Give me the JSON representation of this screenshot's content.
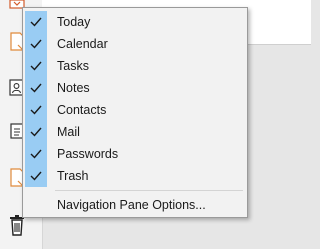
{
  "menu": {
    "items": [
      {
        "label": "Today",
        "checked": true
      },
      {
        "label": "Calendar",
        "checked": true
      },
      {
        "label": "Tasks",
        "checked": true
      },
      {
        "label": "Notes",
        "checked": true
      },
      {
        "label": "Contacts",
        "checked": true
      },
      {
        "label": "Mail",
        "checked": true
      },
      {
        "label": "Passwords",
        "checked": true
      },
      {
        "label": "Trash",
        "checked": true
      }
    ],
    "options_label": "Navigation Pane Options...",
    "check_icon": "checkmark-icon",
    "highlight_color": "#99ccf3"
  },
  "nav_icons": [
    "today-icon",
    "tasks-icon",
    "contacts-icon",
    "notes-icon",
    "passwords-icon",
    "trash-icon"
  ]
}
